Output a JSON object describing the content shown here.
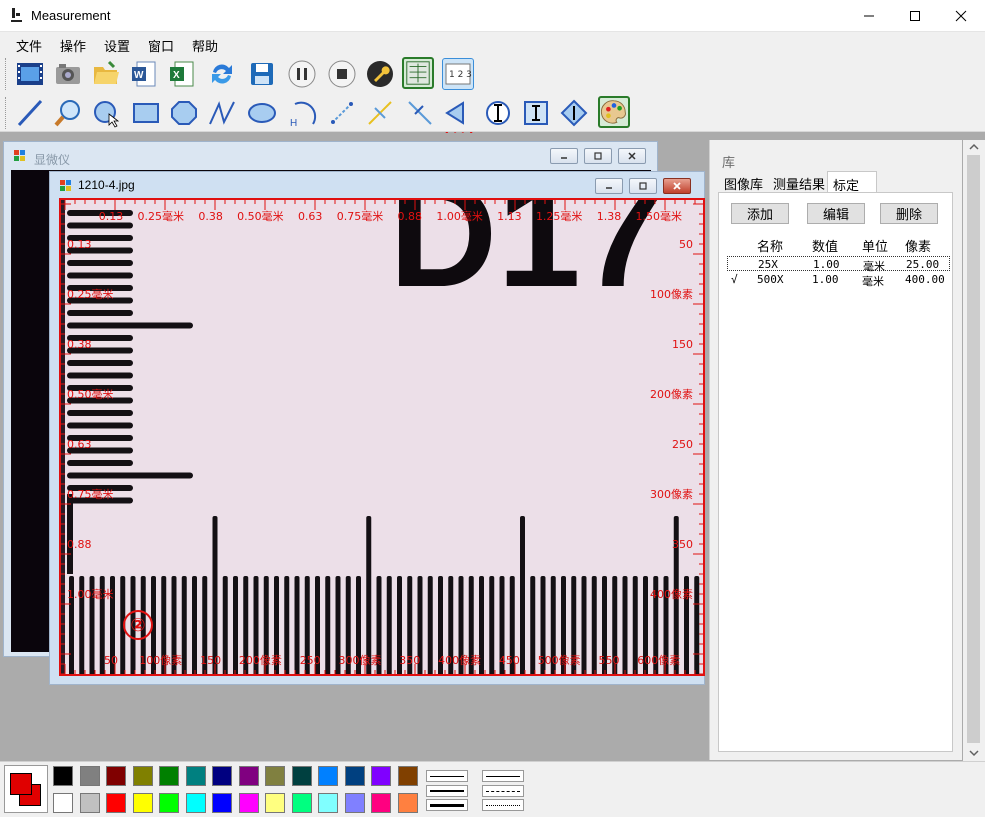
{
  "window": {
    "title": "Measurement",
    "minimize_icon": "minimize-icon",
    "maximize_icon": "maximize-icon",
    "close_icon": "close-icon"
  },
  "menu": [
    "文件",
    "操作",
    "设置",
    "窗口",
    "帮助"
  ],
  "toolbar": {
    "tooltip": "标定",
    "annotation_1": "①",
    "annotation_2": "②"
  },
  "microscope_window": {
    "title": "显微仪"
  },
  "image_window": {
    "title": "1210-4.jpg",
    "image_text": "D17",
    "ruler_top": [
      "0.13",
      "0.25毫米",
      "0.38",
      "0.50毫米",
      "0.63",
      "0.75毫米",
      "0.88",
      "1.00毫米",
      "1.13",
      "1.25毫米",
      "1.38",
      "1.50毫米"
    ],
    "ruler_left": [
      "0.13",
      "0.25毫米",
      "0.38",
      "0.50毫米",
      "0.63",
      "0.75毫米",
      "0.88",
      "1.00毫米"
    ],
    "ruler_right": [
      "50",
      "100像素",
      "150",
      "200像素",
      "250",
      "300像素",
      "350",
      "400像素"
    ],
    "ruler_bottom": [
      "50",
      "100像素",
      "150",
      "200像素",
      "250",
      "300像素",
      "350",
      "400像素",
      "450",
      "500像素",
      "550",
      "600像素"
    ]
  },
  "library_panel": {
    "title": "库",
    "tabs": [
      "图像库",
      "测量结果",
      "标定"
    ],
    "active_tab": "标定",
    "buttons": {
      "add": "添加",
      "edit": "编辑",
      "delete": "删除"
    },
    "columns": [
      "名称",
      "数值",
      "单位",
      "像素"
    ],
    "rows": [
      {
        "check": "",
        "name": "25X",
        "value": "1.00",
        "unit": "毫米",
        "pixels": "25.00"
      },
      {
        "check": "√",
        "name": "500X",
        "value": "1.00",
        "unit": "毫米",
        "pixels": "400.00"
      }
    ]
  },
  "palette": {
    "current_fg": "#e00000",
    "current_bg": "#e00000",
    "colors_top": [
      "#000000",
      "#808080",
      "#800000",
      "#808000",
      "#008000",
      "#008080",
      "#000080",
      "#800080",
      "#808040",
      "#004040",
      "#0080ff",
      "#004080",
      "#8000ff",
      "#804000"
    ],
    "colors_bottom": [
      "#ffffff",
      "#c0c0c0",
      "#ff0000",
      "#ffff00",
      "#00ff00",
      "#00ffff",
      "#0000ff",
      "#ff00ff",
      "#ffff80",
      "#00ff80",
      "#80ffff",
      "#8080ff",
      "#ff0080",
      "#ff8040"
    ]
  }
}
